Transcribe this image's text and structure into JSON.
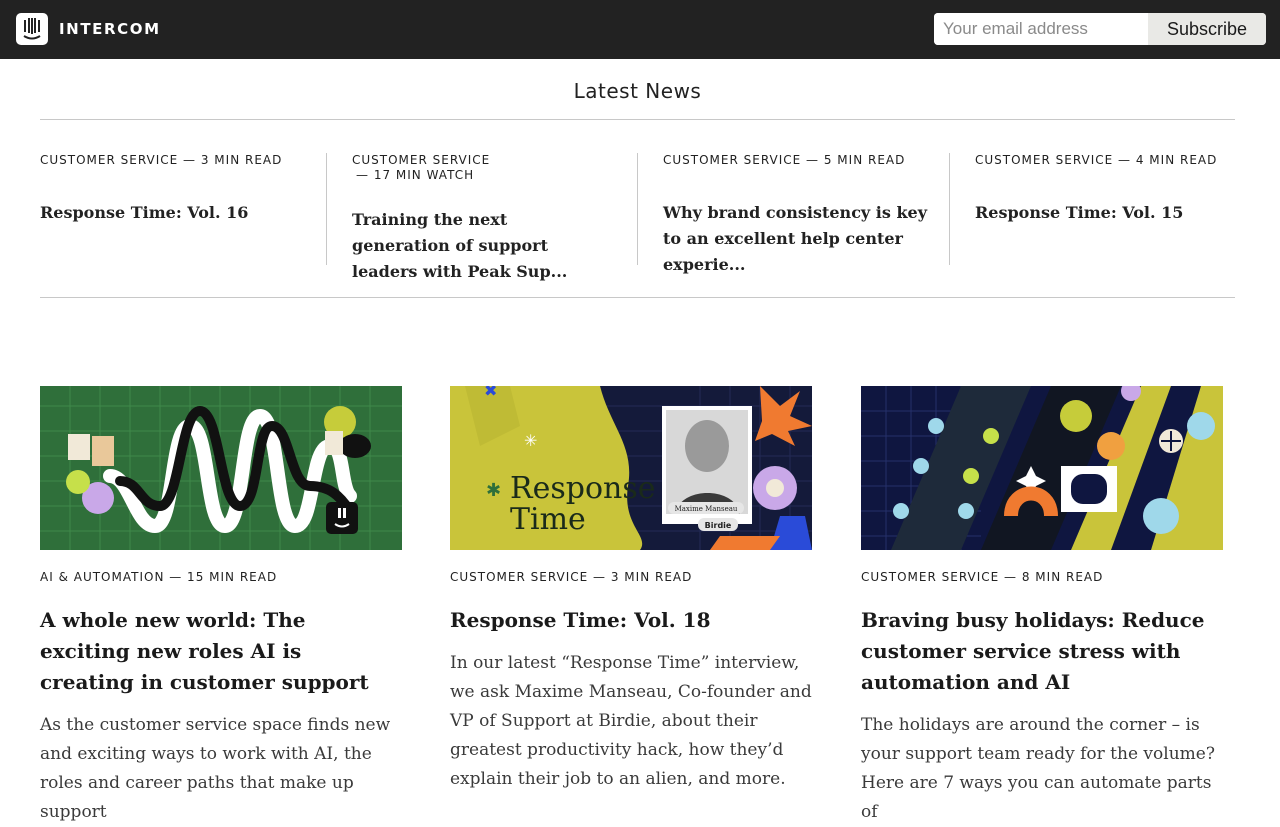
{
  "header": {
    "brand": "INTERCOM",
    "email_placeholder": "Your email address",
    "subscribe_label": "Subscribe"
  },
  "latest": {
    "title": "Latest News",
    "items": [
      {
        "meta_line1": "CUSTOMER SERVICE —  3 MIN READ",
        "meta_line2": "",
        "title": "Response Time: Vol. 16"
      },
      {
        "meta_line1": "CUSTOMER SERVICE",
        "meta_line2": "— 17 MIN WATCH",
        "title": "Training the next generation of support leaders with Peak Sup..."
      },
      {
        "meta_line1": "CUSTOMER SERVICE —  5 MIN READ",
        "meta_line2": "",
        "title": "Why brand consistency is key to an excellent help center experie..."
      },
      {
        "meta_line1": "CUSTOMER SERVICE —  4 MIN READ",
        "meta_line2": "",
        "title": "Response Time: Vol. 15"
      }
    ]
  },
  "cards": [
    {
      "meta": "AI & AUTOMATION — 15 MIN READ",
      "title": "A whole new world: The exciting new roles AI is creating in customer support",
      "desc": "As the customer service space finds new and exciting ways to work with AI, the roles and career paths that make up support"
    },
    {
      "meta": "CUSTOMER SERVICE — 3 MIN READ",
      "title": "Response Time: Vol. 18",
      "desc": "In our latest “Response Time” interview, we ask Maxime Manseau, Co-founder and VP of Support at Birdie, about their greatest productivity hack, how they’d explain their job to an alien, and more.",
      "image_text": {
        "headline_line1": "Response",
        "headline_line2": "Time",
        "person_name": "Maxime Manseau",
        "company": "Birdie"
      }
    },
    {
      "meta": "CUSTOMER SERVICE — 8 MIN READ",
      "title": "Braving busy holidays: Reduce customer service stress with automation and AI",
      "desc": "The holidays are around the corner – is your support team ready for the volume? Here are 7 ways you can automate parts of"
    }
  ],
  "colors": {
    "header_bg": "#222222",
    "card1_bg": "#2f6f3a",
    "card2_bg": "#141a3a",
    "card2_accent": "#c9c43a",
    "card3_bg": "#0f1640"
  }
}
